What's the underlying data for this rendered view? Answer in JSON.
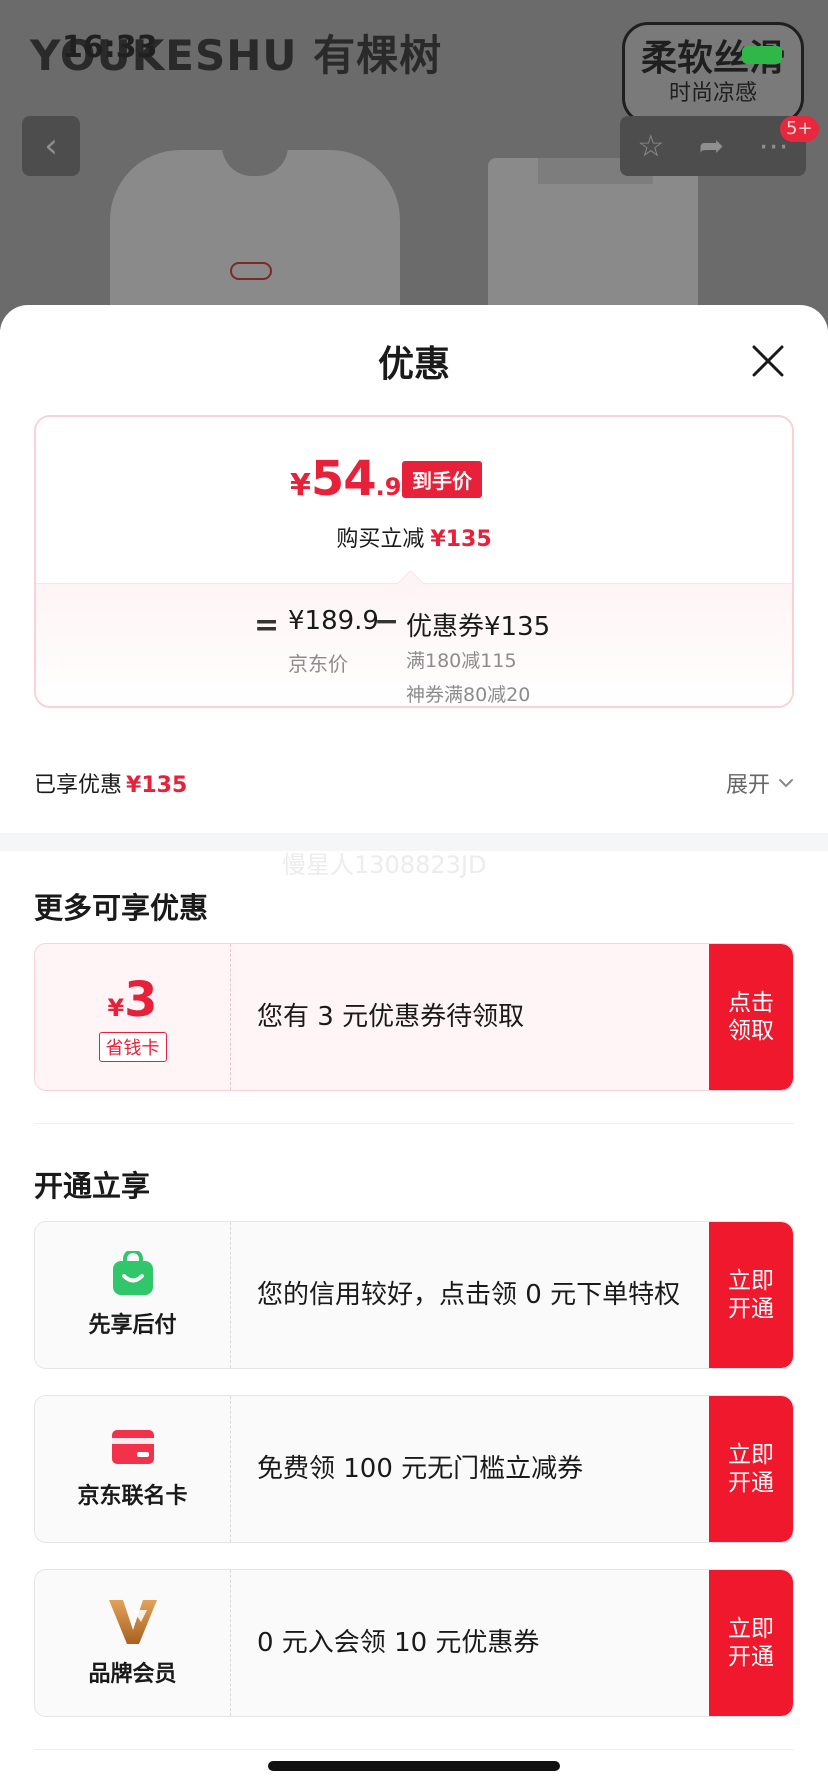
{
  "status_bar": {
    "time": "16:33"
  },
  "product_header": {
    "brand": "YOUKESHU 有棵树",
    "promo_line1": "柔软丝滑",
    "promo_line2": "时尚凉感",
    "notification_count": "5+"
  },
  "sheet": {
    "title": "优惠",
    "price_summary": {
      "currency": "¥",
      "final_int": "54",
      "final_dec": ".9",
      "final_tag": "到手价",
      "buy_reduce_label": "购买立减",
      "buy_reduce_amount": "¥135"
    },
    "calc": {
      "equals": "=",
      "base_price": "¥189.9",
      "base_label": "京东价",
      "minus": "−",
      "coupon": "优惠券¥135",
      "detail_1": "满180减115",
      "detail_2": "神券满80减20"
    },
    "enjoyed": {
      "label": "已享优惠",
      "amount": "¥135",
      "expand": "展开"
    },
    "watermark": "慢星人1308823JD",
    "more_offers": {
      "title": "更多可享优惠",
      "card": {
        "currency": "¥",
        "amount": "3",
        "tag": "省钱卡",
        "text": "您有 3 元优惠券待领取",
        "button": "点击领取"
      }
    },
    "activate": {
      "title": "开通立享",
      "items": [
        {
          "icon": "shopping-bag-icon",
          "label": "先享后付",
          "text": "您的信用较好，点击领 0 元下单特权",
          "button": "立即开通"
        },
        {
          "icon": "credit-card-icon",
          "label": "京东联名卡",
          "text": "免费领 100 元无门槛立减券",
          "button": "立即开通"
        },
        {
          "icon": "brand-v-icon",
          "label": "品牌会员",
          "text": "0 元入会领 10 元优惠券",
          "button": "立即开通"
        }
      ]
    }
  },
  "colors": {
    "accent_red": "#e8213a",
    "button_red": "#f0182d",
    "green_icon": "#2fc76a"
  }
}
